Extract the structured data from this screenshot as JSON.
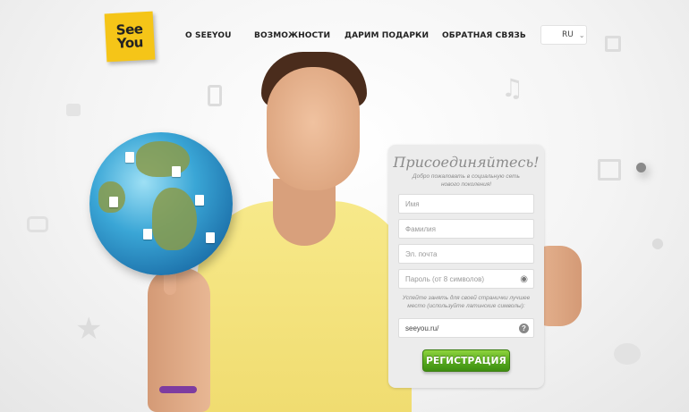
{
  "header": {
    "logo_line1": "See",
    "logo_line2": "You",
    "nav": [
      {
        "label": "О SEEYOU"
      },
      {
        "label": "ВОЗМОЖНОСТИ"
      },
      {
        "label": "ДАРИМ ПОДАРКИ"
      },
      {
        "label": "ОБРАТНАЯ СВЯЗЬ"
      }
    ],
    "language": "RU",
    "language_icon": "globe-icon"
  },
  "registration": {
    "title": "Присоединяйтесь!",
    "subtitle": "Добро пожаловать в социальную сеть нового поколения!",
    "first_name_placeholder": "Имя",
    "last_name_placeholder": "Фамилия",
    "email_placeholder": "Эл. почта",
    "password_placeholder": "Пароль (от 8 символов)",
    "url_note": "Успейте занять для своей странички лучшее место (используйте латинские символы):",
    "url_value": "seeyou.ru/",
    "help_symbol": "?",
    "button_label": "РЕГИСТРАЦИЯ"
  },
  "colors": {
    "logo_yellow": "#f5c518",
    "button_green": "#55a81d",
    "shirt_yellow": "#f0dc70"
  }
}
